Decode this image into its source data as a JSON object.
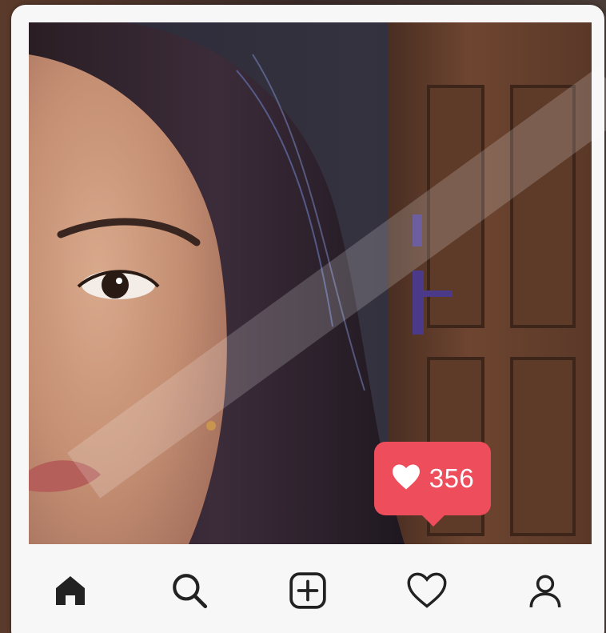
{
  "post": {
    "like_count": "356"
  },
  "icons": {
    "like_bubble_icon": "heart-icon",
    "nav": [
      "home-icon",
      "search-icon",
      "add-post-icon",
      "activity-heart-icon",
      "profile-icon"
    ]
  },
  "colors": {
    "like_bubble": "#ee4d5c",
    "card_background": "#f7f7f7",
    "nav_icon": "#222222"
  }
}
